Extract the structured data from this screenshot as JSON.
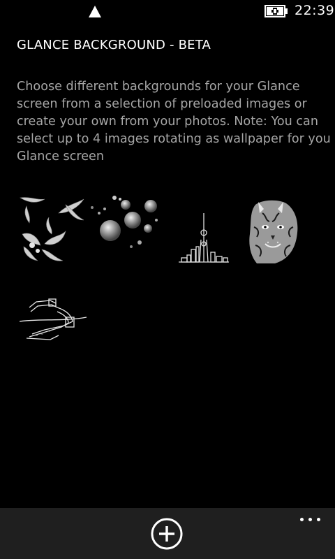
{
  "status_bar": {
    "time": "22:39",
    "signal_icon": "signal-triangle-icon",
    "battery_icon": "battery-charging-icon"
  },
  "header": {
    "title": "GLANCE BACKGROUND - BETA"
  },
  "main": {
    "description": "Choose different backgrounds for your Glance screen from a selection of preloaded images or create your own from your photos. Note: You can select up to 4 images rotating as wallpaper for you Glance screen",
    "thumbnails": [
      {
        "icon": "bamboo-leaves-image"
      },
      {
        "icon": "lanterns-image"
      },
      {
        "icon": "city-skyline-image"
      },
      {
        "icon": "tiger-image"
      },
      {
        "icon": "great-wall-image"
      }
    ]
  },
  "app_bar": {
    "add_icon": "add-circle-icon",
    "more_icon": "more-ellipsis-icon"
  },
  "colors": {
    "background": "#000000",
    "app_bar": "#1f1f1f",
    "text_primary": "#ffffff",
    "text_secondary": "#a6a6a6"
  }
}
